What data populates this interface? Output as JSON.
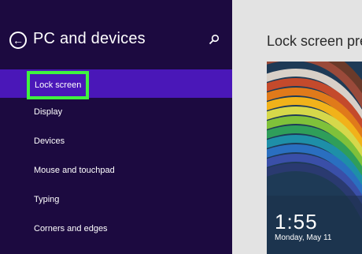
{
  "header": {
    "title": "PC and devices",
    "back_icon": "back-arrow-icon",
    "search_icon": "search-icon"
  },
  "nav": {
    "items": [
      {
        "label": "Lock screen",
        "selected": true
      },
      {
        "label": "Display"
      },
      {
        "label": "Devices"
      },
      {
        "label": "Mouse and touchpad"
      },
      {
        "label": "Typing"
      },
      {
        "label": "Corners and edges"
      }
    ]
  },
  "content": {
    "title": "Lock screen pre",
    "clock_time": "1:55",
    "clock_date": "Monday, May 11"
  },
  "colors": {
    "sidebar_bg": "#1c0a40",
    "selected_bg": "#4a17b8",
    "highlight_outline": "#3ff33f",
    "content_bg": "#e3e3e3"
  }
}
